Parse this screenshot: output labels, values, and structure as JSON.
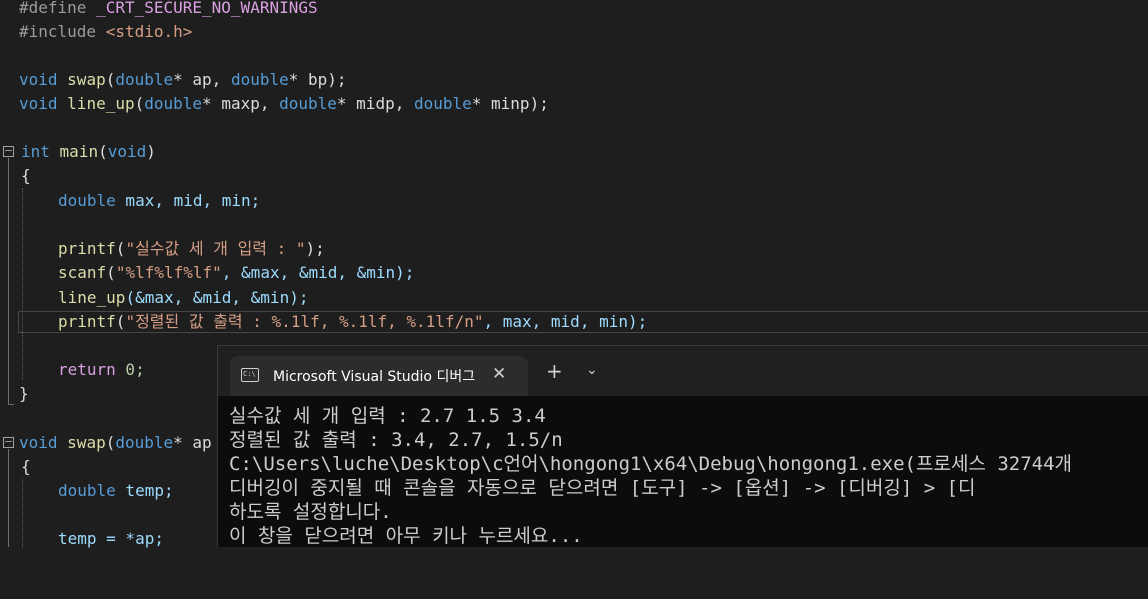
{
  "editor": {
    "code": {
      "l1a": "#define ",
      "l1b": "_CRT_SECURE_NO_WARNINGS",
      "l2a": "#include ",
      "l2b": "<stdio.h>",
      "void": "void",
      "double": "double",
      "int": "int",
      "swap": "swap",
      "line_up": "line_up",
      "main": "main",
      "ap": "* ap, ",
      "bp": "* bp);",
      "maxp": "* maxp, ",
      "midp": "* midp, ",
      "minp": "* minp);",
      "lp": "(",
      "rp": ")",
      "brace_open": "{",
      "brace_close": "}",
      "decl_vars": " max, mid, min;",
      "printf": "printf",
      "scanf": "scanf",
      "str1": "\"실수값 세 개 입력 : \"",
      "end1": ");",
      "str2": "\"%lf%lf%lf\"",
      "args2": ", &max, &mid, &min);",
      "call_args": "(&max, &mid, &min);",
      "str3": "\"정렬된 값 출력 : %.1lf, %.1lf, %.1lf/n\"",
      "args3": ", max, mid, min);",
      "return": "return",
      "zero": " 0;",
      "ap_partial": "* ap",
      "temp_decl": " temp;",
      "temp_assign": "temp = *ap;"
    }
  },
  "terminal": {
    "tab_title": "Microsoft Visual Studio 디버그",
    "tab_icon_text": "C:\\",
    "close": "✕",
    "new_tab": "+",
    "dropdown": "⌄",
    "lines": [
      "실수값 세 개 입력 : 2.7 1.5 3.4",
      "정렬된 값 출력 : 3.4, 2.7, 1.5/n",
      "C:\\Users\\luche\\Desktop\\c언어\\hongong1\\x64\\Debug\\hongong1.exe(프로세스 32744개",
      "디버깅이 중지될 때 콘솔을 자동으로 닫으려면 [도구] -> [옵션] -> [디버깅] > [디",
      "하도록 설정합니다.",
      "이 창을 닫으려면 아무 키나 누르세요..."
    ]
  },
  "icons": {
    "fold": "fold-collapse-icon",
    "terminal": "terminal-icon"
  },
  "colors": {
    "keyword": "#569cd6",
    "function": "#dcdcaa",
    "string": "#d69d85",
    "variable": "#9cdcfe",
    "background": "#1e1e1e",
    "terminal_bg": "#0c0c0c"
  }
}
